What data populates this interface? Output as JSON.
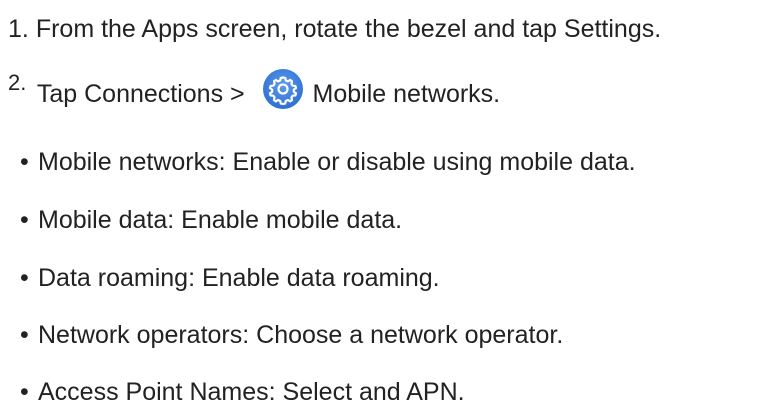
{
  "steps": [
    {
      "number": "1.",
      "text": "From the Apps screen, rotate the bezel and tap Settings."
    },
    {
      "number": "2.",
      "text_before": "Tap Connections >",
      "icon": "settings-gear-icon",
      "text_after": "Mobile networks.",
      "icon_color": "#3d82e0"
    }
  ],
  "bullets": [
    "Mobile networks: Enable or disable using mobile data.",
    "Mobile data: Enable mobile data.",
    "Data roaming: Enable data roaming.",
    "Network operators: Choose a network operator.",
    "Access Point Names: Select and APN."
  ],
  "bullet_glyph": "•",
  "text_color": "#222222"
}
